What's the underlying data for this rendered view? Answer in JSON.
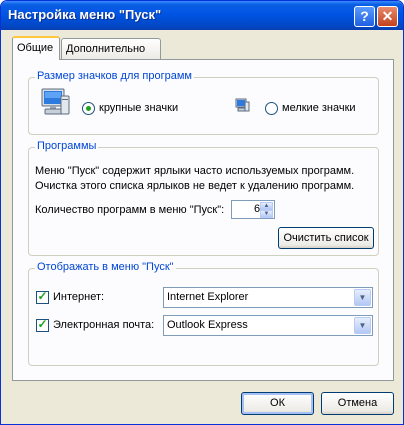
{
  "window": {
    "title": "Настройка меню \"Пуск\""
  },
  "titlebar_buttons": {
    "help_glyph": "?",
    "close_glyph": "✕"
  },
  "tabs": [
    {
      "label": "Общие",
      "active": true
    },
    {
      "label": "Дополнительно",
      "active": false
    }
  ],
  "icon_size": {
    "legend": "Размер значков для программ",
    "large_label": "крупные значки",
    "small_label": "мелкие значки",
    "selected": "large",
    "icons": [
      "large-computer-icon",
      "small-computer-icon"
    ]
  },
  "programs": {
    "legend": "Программы",
    "description_line1": "Меню \"Пуск\" содержит ярлыки часто используемых программ.",
    "description_line2": "Очистка этого списка ярлыков не ведет к удалению программ.",
    "count_label": "Количество программ в меню \"Пуск\":",
    "count_value": "6",
    "clear_button": "Очистить список"
  },
  "show_in_menu": {
    "legend": "Отображать в меню \"Пуск\"",
    "internet_label": "Интернет:",
    "internet_checked": true,
    "internet_value": "Internet Explorer",
    "email_label": "Электронная почта:",
    "email_checked": true,
    "email_value": "Outlook Express"
  },
  "footer": {
    "ok_label": "ОК",
    "cancel_label": "Отмена"
  },
  "colors": {
    "titlebar": "#0054E3",
    "dialog_bg": "#ECE9D8",
    "group_legend": "#0046D5",
    "check_green": "#21A121",
    "active_tab_accent": "#FFC83C"
  }
}
